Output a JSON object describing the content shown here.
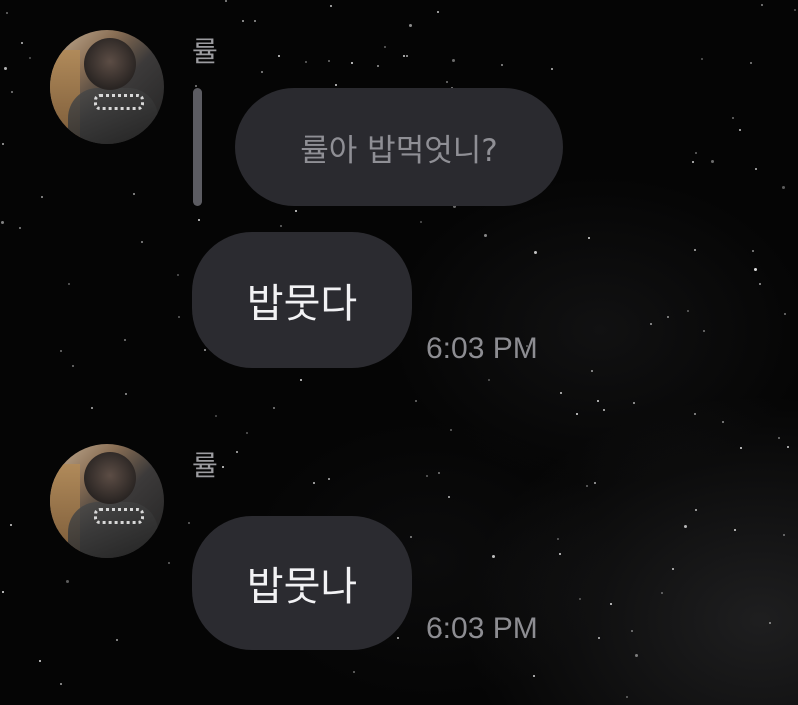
{
  "messages": [
    {
      "sender": "률",
      "reply_to_text": "률아 밥먹엇니?",
      "text": "밥뭇다",
      "time": "6:03 PM"
    },
    {
      "sender": "률",
      "text": "밥뭇나",
      "time": "6:03 PM"
    }
  ],
  "colors": {
    "background": "#050505",
    "bubble": "#2b2b30",
    "text": "#f2f2f4",
    "muted_text": "#8d8d92"
  }
}
